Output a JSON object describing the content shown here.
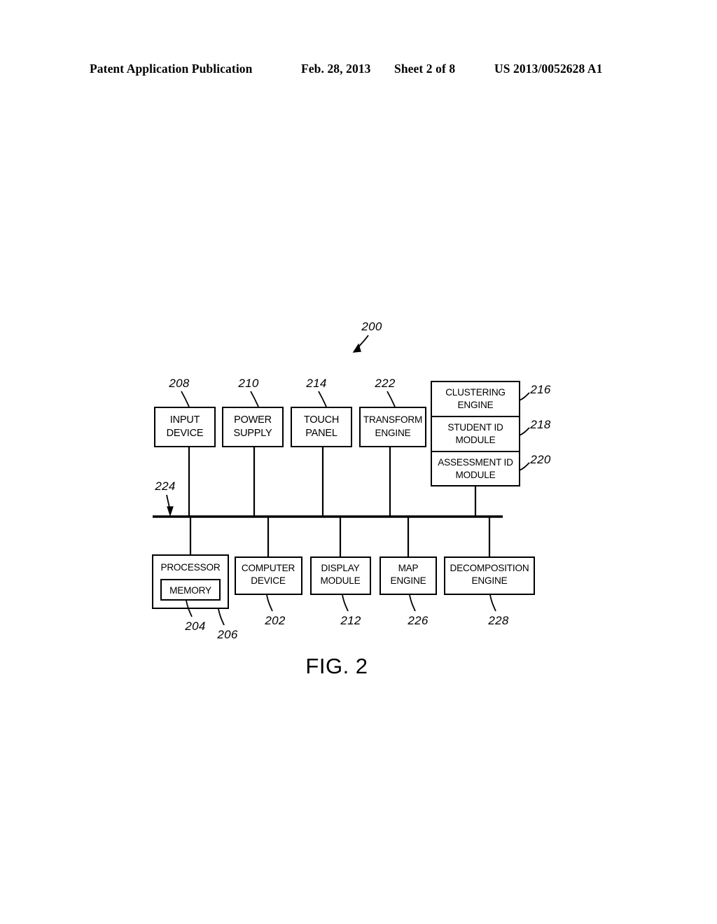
{
  "header": {
    "title": "Patent Application Publication",
    "date": "Feb. 28, 2013",
    "sheet": "Sheet 2 of 8",
    "doc_number": "US 2013/0052628 A1"
  },
  "figure": {
    "caption": "FIG. 2",
    "system_ref": "200",
    "bus_ref": "224",
    "line_color": "#000000",
    "background": "#ffffff"
  },
  "diagram": {
    "top_row": [
      {
        "id": "input-device",
        "ref": "208",
        "line1": "INPUT",
        "line2": "DEVICE"
      },
      {
        "id": "power-supply",
        "ref": "210",
        "line1": "POWER",
        "line2": "SUPPLY"
      },
      {
        "id": "touch-panel",
        "ref": "214",
        "line1": "TOUCH",
        "line2": "PANEL"
      },
      {
        "id": "transform-engine",
        "ref": "222",
        "line1": "TRANSFORM",
        "line2": "ENGINE"
      }
    ],
    "stacked_module": {
      "id": "clustering-stack",
      "cells": [
        {
          "id": "clustering-engine",
          "ref": "216",
          "line1": "CLUSTERING",
          "line2": "ENGINE"
        },
        {
          "id": "student-id-module",
          "ref": "218",
          "line1": "STUDENT ID",
          "line2": "MODULE"
        },
        {
          "id": "assessment-id-module",
          "ref": "220",
          "line1": "ASSESSMENT ID",
          "line2": "MODULE"
        }
      ]
    },
    "bottom_row": [
      {
        "id": "processor",
        "ref": "206",
        "line1": "PROCESSOR",
        "line2": ""
      },
      {
        "id": "computer-device",
        "ref": "202",
        "line1": "COMPUTER",
        "line2": "DEVICE"
      },
      {
        "id": "display-module",
        "ref": "212",
        "line1": "DISPLAY",
        "line2": "MODULE"
      },
      {
        "id": "map-engine",
        "ref": "226",
        "line1": "MAP",
        "line2": "ENGINE"
      },
      {
        "id": "decomposition-engine",
        "ref": "228",
        "line1": "DECOMPOSITION",
        "line2": "ENGINE"
      }
    ],
    "memory": {
      "id": "memory",
      "ref": "204",
      "label": "MEMORY"
    }
  }
}
